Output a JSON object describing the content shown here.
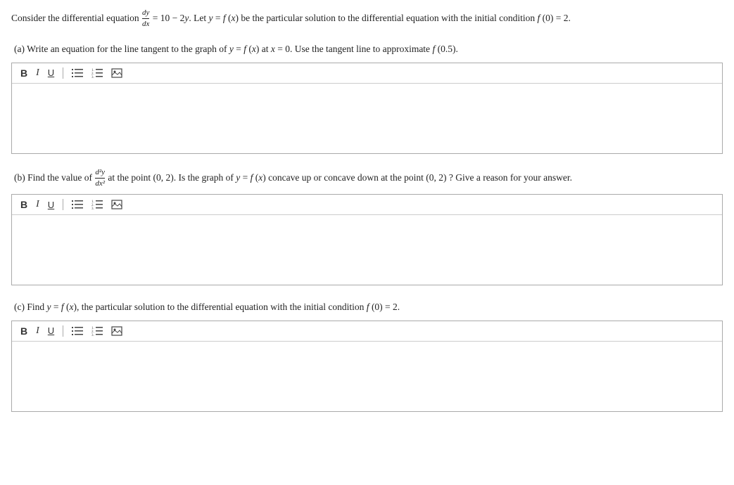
{
  "header": {
    "text_before": "Consider the differential equation",
    "equation": "dy/dx = 10 − 2y",
    "text_after": ". Let y = f (x) be the particular solution to the differential equation with the initial condition f (0) = 2."
  },
  "questions": [
    {
      "id": "a",
      "label": "(a)",
      "text": " Write an equation for the line tangent to the graph of y = f (x) at x = 0. Use the tangent line to approximate f (0.5)."
    },
    {
      "id": "b",
      "label": "(b)",
      "text_before": " Find the value of",
      "fraction_num": "d²y",
      "fraction_den": "dx²",
      "text_after": " at the point (0, 2). Is the graph of y = f (x) concave up or concave down at the point (0, 2) ? Give a reason for your answer."
    },
    {
      "id": "c",
      "label": "(c)",
      "text": " Find y = f (x), the particular solution to the differential equation with the initial condition f (0) = 2."
    }
  ],
  "toolbar": {
    "bold_label": "B",
    "italic_label": "I",
    "underline_label": "U",
    "list_unordered_icon": "☰",
    "list_ordered_icon": "☰",
    "image_icon": "▣"
  }
}
